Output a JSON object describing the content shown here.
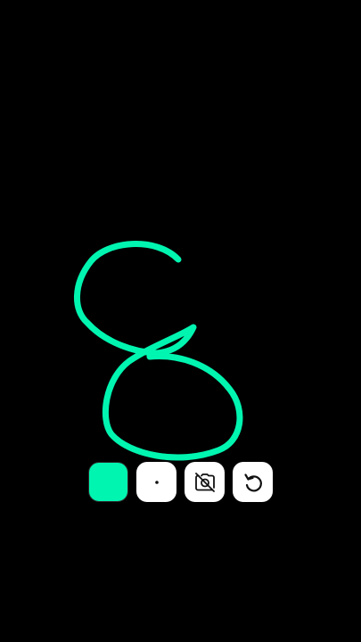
{
  "canvas": {
    "background_color": "#000000",
    "stroke_color": "#00f5b0",
    "drawn_shape": "figure-eight scribble"
  },
  "toolbar": {
    "buttons": [
      {
        "name": "color-swatch-button",
        "icon": "filled-square",
        "color": "#00f5b0"
      },
      {
        "name": "brush-size-button",
        "icon": "small-dot-icon"
      },
      {
        "name": "camera-off-button",
        "icon": "camera-off-icon"
      },
      {
        "name": "undo-button",
        "icon": "rotate-ccw-icon"
      }
    ],
    "button_background": "#ffffff",
    "icon_color": "#111111"
  }
}
